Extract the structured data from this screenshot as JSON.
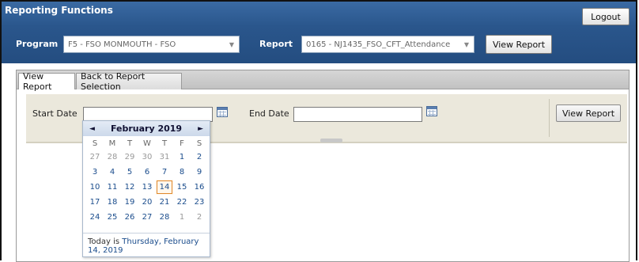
{
  "header": {
    "title": "Reporting Functions",
    "logout_label": "Logout",
    "program_label": "Program",
    "program_value": "F5 - FSO MONMOUTH - FSO",
    "report_label": "Report",
    "report_value": "0165 - NJ1435_FSO_CFT_Attendance",
    "view_report_label": "View Report"
  },
  "tabs": [
    {
      "label": "View Report",
      "active": true
    },
    {
      "label": "Back to Report Selection",
      "active": false
    }
  ],
  "filters": {
    "start_date_label": "Start Date",
    "start_date_value": "",
    "end_date_label": "End Date",
    "end_date_value": "",
    "view_report_label": "View Report"
  },
  "calendar": {
    "month_label": "February 2019",
    "prev_icon": "◄",
    "next_icon": "►",
    "weekdays": [
      "S",
      "M",
      "T",
      "W",
      "T",
      "F",
      "S"
    ],
    "weeks": [
      [
        "27",
        "28",
        "29",
        "30",
        "31",
        "1",
        "2"
      ],
      [
        "3",
        "4",
        "5",
        "6",
        "7",
        "8",
        "9"
      ],
      [
        "10",
        "11",
        "12",
        "13",
        "14",
        "15",
        "16"
      ],
      [
        "17",
        "18",
        "19",
        "20",
        "21",
        "22",
        "23"
      ],
      [
        "24",
        "25",
        "26",
        "27",
        "28",
        "1",
        "2"
      ]
    ],
    "today_prefix": "Today is ",
    "today_date": "Thursday, February 14, 2019"
  },
  "colors": {
    "header_bg": "#2a568c",
    "filter_bg": "#ebe8dc",
    "link_blue": "#1a4c8c",
    "today_border": "#e08a2e"
  }
}
